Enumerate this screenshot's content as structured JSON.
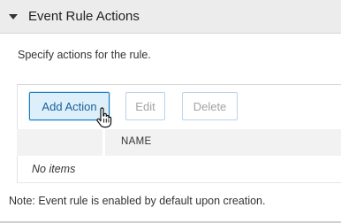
{
  "section": {
    "title": "Event Rule Actions",
    "expand_icon": "caret-down-icon"
  },
  "description": "Specify actions for the rule.",
  "toolbar": {
    "add_label": "Add Action",
    "edit_label": "Edit",
    "delete_label": "Delete"
  },
  "table": {
    "columns": [
      "",
      "NAME"
    ],
    "empty_text": "No items"
  },
  "note": "Note: Event rule is enabled by default upon creation.",
  "cursor_icon": "hand-pointer-icon",
  "colors": {
    "header_bg": "#ececec",
    "primary_button_bg": "#dceffb",
    "primary_button_border": "#1f7dbf",
    "disabled_text": "#a3a3a3",
    "table_header_bg": "#f2f2f2"
  }
}
